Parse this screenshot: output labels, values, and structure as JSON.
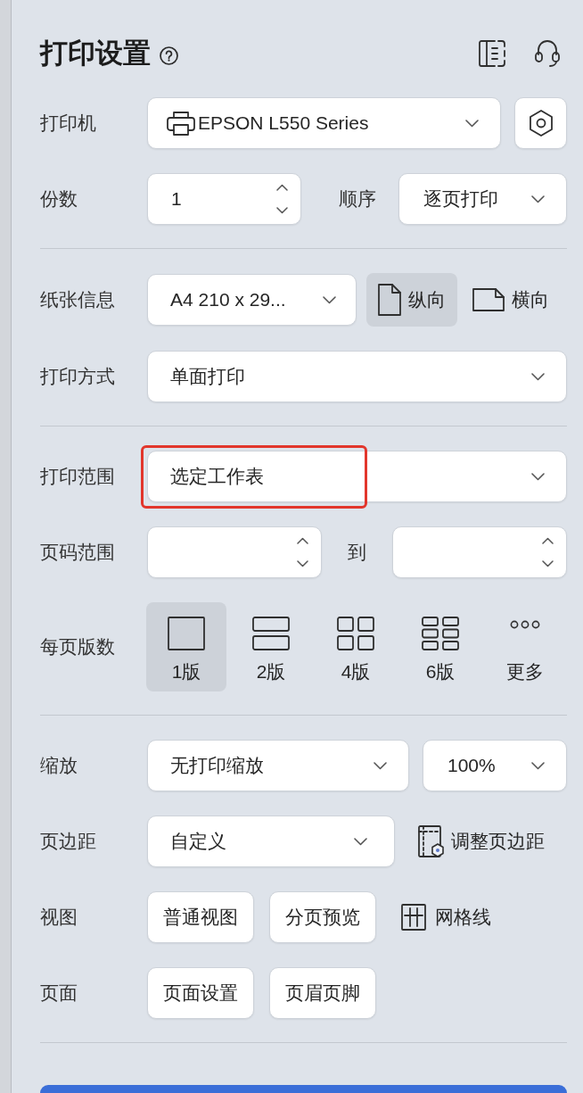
{
  "header": {
    "title": "打印设置"
  },
  "sections": [
    {
      "rows": [
        {
          "kind": "printer",
          "label": "打印机",
          "value": "EPSON L550 Series"
        },
        {
          "kind": "copies",
          "label": "份数",
          "value": "1",
          "order_label": "顺序",
          "order_value": "逐页打印"
        }
      ]
    },
    {
      "rows": [
        {
          "kind": "paper",
          "label": "纸张信息",
          "value": "A4 210 x 29...",
          "orientations": [
            {
              "kind": "portrait",
              "label": "纵向",
              "selected": true
            },
            {
              "kind": "landscape",
              "label": "横向",
              "selected": false
            }
          ]
        },
        {
          "kind": "select",
          "label": "打印方式",
          "value": "单面打印",
          "highlighted": false
        }
      ]
    },
    {
      "rows": [
        {
          "kind": "select",
          "label": "打印范围",
          "value": "选定工作表",
          "highlighted": true
        },
        {
          "kind": "range",
          "label": "页码范围",
          "to_label": "到"
        },
        {
          "kind": "layouts",
          "label": "每页版数",
          "options": [
            {
              "kind": "one",
              "label": "1版",
              "selected": true
            },
            {
              "kind": "two",
              "label": "2版",
              "selected": false
            },
            {
              "kind": "four",
              "label": "4版",
              "selected": false
            },
            {
              "kind": "six",
              "label": "6版",
              "selected": false
            },
            {
              "kind": "more",
              "label": "更多",
              "selected": false
            }
          ]
        }
      ]
    },
    {
      "rows": [
        {
          "kind": "zoom",
          "label": "缩放",
          "value": "无打印缩放",
          "scale": "100%"
        },
        {
          "kind": "margins",
          "label": "页边距",
          "value": "自定义",
          "link": "调整页边距"
        },
        {
          "kind": "buttons",
          "label": "视图",
          "buttons": [
            "普通视图",
            "分页预览"
          ],
          "toggle": "网格线"
        },
        {
          "kind": "buttons",
          "label": "页面",
          "buttons": [
            "页面设置",
            "页眉页脚"
          ]
        }
      ]
    }
  ]
}
